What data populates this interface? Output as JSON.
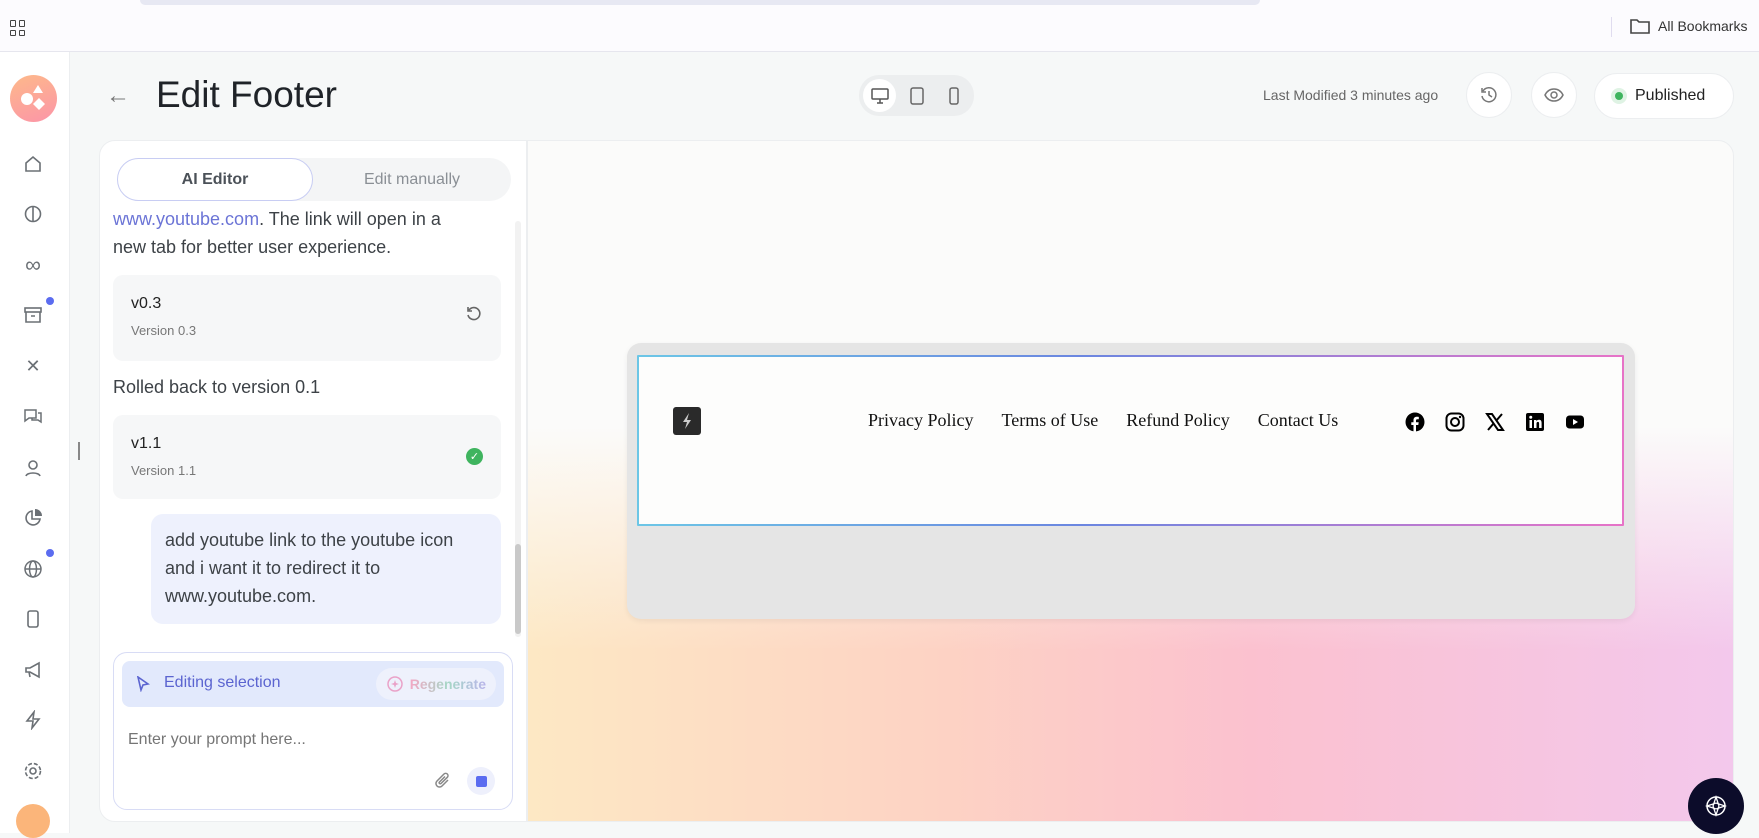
{
  "browser": {
    "bookmarks_label": "All Bookmarks",
    "apps_icon": "grid-icon"
  },
  "header": {
    "title": "Edit Footer",
    "last_modified": "Last Modified 3 minutes ago",
    "status": "Published",
    "status_color": "#3fb45f",
    "accent": "#5b6cf0"
  },
  "sidebar": {
    "items": [
      "home",
      "brain",
      "infinity",
      "archive",
      "tools",
      "chat",
      "user",
      "pie-chart",
      "globe",
      "mobile",
      "megaphone",
      "bolt",
      "settings"
    ]
  },
  "editor": {
    "tabs": [
      {
        "label": "AI Editor",
        "active": true
      },
      {
        "label": "Edit manually",
        "active": false
      }
    ],
    "messages": {
      "partial_link": "www.youtube.com",
      "partial_rest": ". The link will open in a",
      "partial_line2": "new tab for better user experience.",
      "version_a": {
        "title": "v0.3",
        "subtitle": "Version 0.3"
      },
      "rollback_text": "Rolled back to version 0.1",
      "version_b": {
        "title": "v1.1",
        "subtitle": "Version 1.1"
      },
      "user_message": "add youtube link to the youtube icon and i want it to redirect it to www.youtube.com."
    },
    "editing_selection": "Editing selection",
    "regenerate": "Regenerate",
    "prompt_placeholder": "Enter your prompt here..."
  },
  "footer_preview": {
    "links": [
      "Privacy Policy",
      "Terms of Use",
      "Refund Policy",
      "Contact Us"
    ],
    "social": [
      "facebook",
      "instagram",
      "x",
      "linkedin",
      "youtube"
    ]
  }
}
